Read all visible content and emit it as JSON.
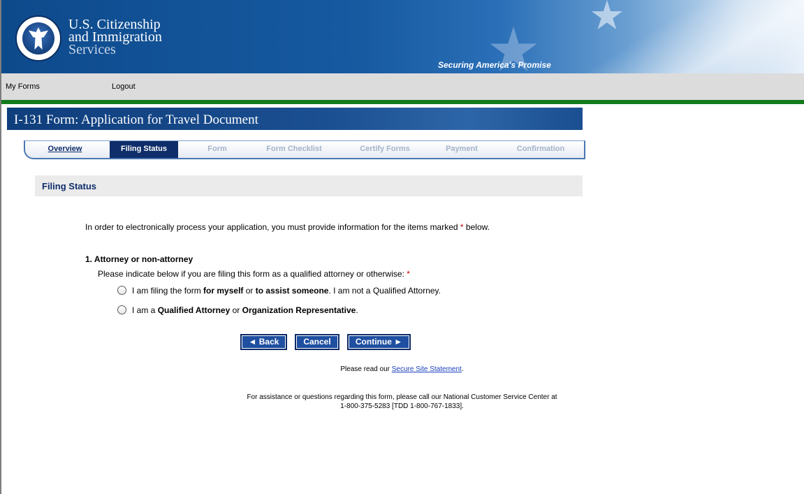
{
  "header": {
    "agency_line1": "U.S. Citizenship",
    "agency_line2": "and Immigration",
    "agency_line3": "Services",
    "tagline": "Securing America's Promise"
  },
  "topnav": {
    "my_forms": "My Forms",
    "logout": "Logout"
  },
  "banner": {
    "title": "I-131 Form: Application for Travel Document"
  },
  "steps": [
    {
      "label": "Overview",
      "state": "link"
    },
    {
      "label": "Filing Status",
      "state": "active"
    },
    {
      "label": "Form",
      "state": "disabled"
    },
    {
      "label": "Form Checklist",
      "state": "disabled"
    },
    {
      "label": "Certify Forms",
      "state": "disabled"
    },
    {
      "label": "Payment",
      "state": "disabled"
    },
    {
      "label": "Confirmation",
      "state": "disabled"
    }
  ],
  "section": {
    "title": "Filing Status"
  },
  "intro": {
    "text": "In order to electronically process your application, you must provide information for the items marked",
    "req_mark": "*",
    "text_end": " below."
  },
  "question": {
    "title": "1. Attorney or non-attorney",
    "prompt": "Please indicate below if you are filing this form as a qualified attorney or otherwise:",
    "req_mark": "*",
    "option1": {
      "p1": "I am filing the form ",
      "b1": "for myself",
      "p2": " or ",
      "b2": "to assist someone",
      "p3": ". I am not a Qualified Attorney."
    },
    "option2": {
      "p1": "I am a ",
      "b1": "Qualified Attorney",
      "p2": " or ",
      "b2": "Organization Representative",
      "p3": "."
    }
  },
  "buttons": {
    "back": "◄ Back",
    "cancel": "Cancel",
    "continue": "Continue ►"
  },
  "footer": {
    "secure_prefix": "Please read our ",
    "secure_link": "Secure Site Statement",
    "secure_suffix": ".",
    "assist_line1": "For assistance or questions regarding this form, please call our National Customer Service Center at",
    "assist_line2": "1-800-375-5283 [TDD 1-800-767-1833]."
  },
  "colors": {
    "header_blue": "#0d4a8c",
    "nav_grey": "#dcdcdc",
    "green_rule": "#137b1e",
    "active_step": "#0e2d6a",
    "button_blue": "#1f4fa0",
    "required_red": "#cc0000"
  },
  "icons": {
    "seal": "dhs-seal-icon",
    "stars": "star-icon"
  }
}
